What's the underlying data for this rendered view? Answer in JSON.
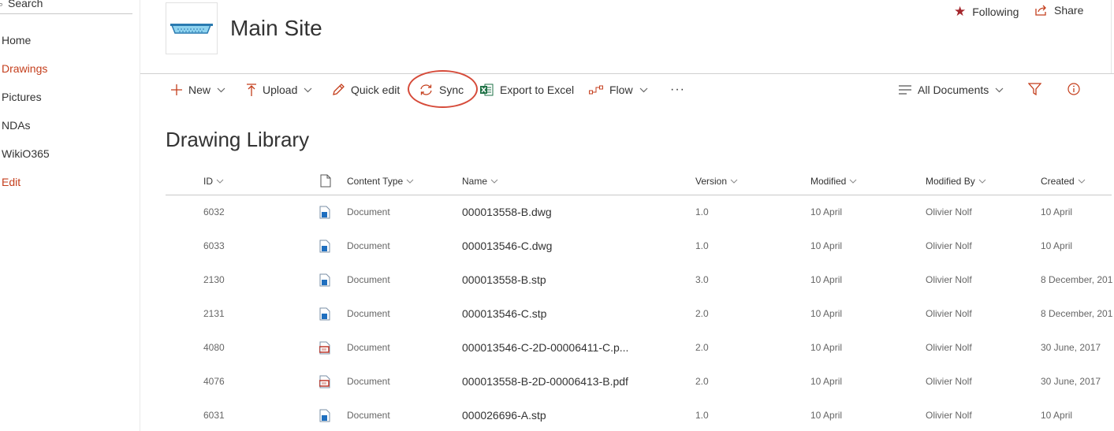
{
  "search": {
    "label": "Search"
  },
  "nav": {
    "items": [
      {
        "label": "Home"
      },
      {
        "label": "Drawings"
      },
      {
        "label": "Pictures"
      },
      {
        "label": "NDAs"
      },
      {
        "label": "WikiO365"
      }
    ],
    "edit_label": "Edit"
  },
  "header": {
    "site_title": "Main Site",
    "following_label": "Following",
    "share_label": "Share"
  },
  "commands": {
    "new_label": "New",
    "upload_label": "Upload",
    "quick_edit_label": "Quick edit",
    "sync_label": "Sync",
    "export_label": "Export to Excel",
    "flow_label": "Flow",
    "more_label": "···",
    "view_label": "All Documents"
  },
  "library": {
    "title": "Drawing Library",
    "columns": {
      "id": "ID",
      "content_type": "Content Type",
      "name": "Name",
      "version": "Version",
      "modified": "Modified",
      "modified_by": "Modified By",
      "created": "Created"
    },
    "rows": [
      {
        "id": "6032",
        "icon": "dwg-file-icon",
        "content_type": "Document",
        "name": "000013558-B.dwg",
        "version": "1.0",
        "modified": "10 April",
        "modified_by": "Olivier Nolf",
        "created": "10 April"
      },
      {
        "id": "6033",
        "icon": "dwg-file-icon",
        "content_type": "Document",
        "name": "000013546-C.dwg",
        "version": "1.0",
        "modified": "10 April",
        "modified_by": "Olivier Nolf",
        "created": "10 April"
      },
      {
        "id": "2130",
        "icon": "stp-file-icon",
        "content_type": "Document",
        "name": "000013558-B.stp",
        "version": "3.0",
        "modified": "10 April",
        "modified_by": "Olivier Nolf",
        "created": "8 December, 201"
      },
      {
        "id": "2131",
        "icon": "stp-file-icon",
        "content_type": "Document",
        "name": "000013546-C.stp",
        "version": "2.0",
        "modified": "10 April",
        "modified_by": "Olivier Nolf",
        "created": "8 December, 201"
      },
      {
        "id": "4080",
        "icon": "pdf-file-icon",
        "content_type": "Document",
        "name": "000013546-C-2D-00006411-C.p...",
        "version": "2.0",
        "modified": "10 April",
        "modified_by": "Olivier Nolf",
        "created": "30 June, 2017"
      },
      {
        "id": "4076",
        "icon": "pdf-file-icon",
        "content_type": "Document",
        "name": "000013558-B-2D-00006413-B.pdf",
        "version": "2.0",
        "modified": "10 April",
        "modified_by": "Olivier Nolf",
        "created": "30 June, 2017"
      },
      {
        "id": "6031",
        "icon": "stp-file-icon",
        "content_type": "Document",
        "name": "000026696-A.stp",
        "version": "1.0",
        "modified": "10 April",
        "modified_by": "Olivier Nolf",
        "created": "10 April"
      }
    ]
  },
  "colors": {
    "accent": "#c43e1c",
    "highlight_circle": "#d64b3a",
    "star": "#a4262c",
    "excel_green": "#1e7145"
  }
}
